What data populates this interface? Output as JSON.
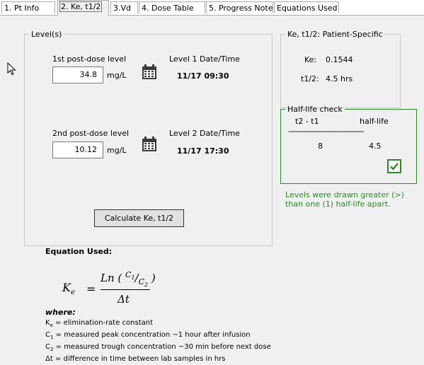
{
  "tabs": [
    {
      "label": "1. Pt Info",
      "active": false
    },
    {
      "label": "2. Ke, t1/2",
      "active": true
    },
    {
      "label": "3.Vd",
      "active": false
    },
    {
      "label": "4. Dose Table",
      "active": false
    },
    {
      "label": "5. Progress Note",
      "active": false
    },
    {
      "label": "Equations Used",
      "active": false
    }
  ],
  "levels": {
    "legend": "Level(s)",
    "first": {
      "label": "1st post-dose level",
      "value": "34.8",
      "unit": "mg/L",
      "datetime_label": "Level 1 Date/Time",
      "datetime": "11/17 09:30"
    },
    "second": {
      "label": "2nd post-dose level",
      "value": "10.12",
      "unit": "mg/L",
      "datetime_label": "Level 2 Date/Time",
      "datetime": "11/17 17:30"
    },
    "calculate_button": "Calculate Ke, t1/2"
  },
  "ke_panel": {
    "legend": "Ke, t1/2: Patient-Specific",
    "ke_label": "Ke:",
    "ke_value": "0.1544",
    "t12_label": "t1/2:",
    "t12_value": "4.5 hrs"
  },
  "halflife_check": {
    "legend": "Half-life check",
    "col1": "t2 - t1",
    "col2": "half-life",
    "separator": "------------------------------------",
    "val1": "8",
    "val2": "4.5",
    "checked": true,
    "message": "Levels were drawn greater (>) than one (1) half-life apart.",
    "color": "#2c8a2c"
  },
  "equation": {
    "heading": "Equation Used:",
    "where": "where",
    "defs": [
      {
        "sym": "K",
        "sub": "e",
        "text": " = elimination-rate constant"
      },
      {
        "sym": "C",
        "sub": "1",
        "text": " = measured peak concentration ~1 hour after infusion"
      },
      {
        "sym": "C",
        "sub": "2",
        "text": " = measured trough concentration ~30 min before next dose"
      },
      {
        "sym": "Δt",
        "sub": "",
        "text": " = difference in time between lab samples in hrs"
      }
    ]
  }
}
